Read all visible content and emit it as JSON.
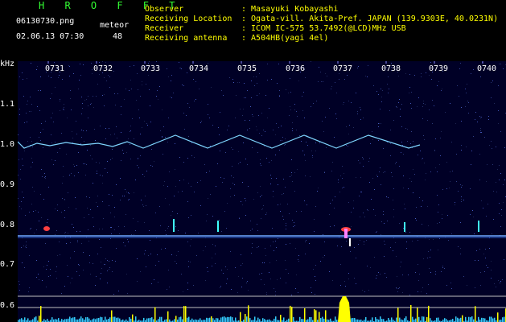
{
  "header": {
    "title": "H R O F F T",
    "filename": "06130730.png",
    "datetime": "02.06.13 07:30",
    "counter_label": "meteor",
    "counter_value": "48",
    "fields": [
      {
        "label": "Observer",
        "value": ": Masayuki Kobayashi"
      },
      {
        "label": "Receiving Location",
        "value": ": Ogata-vill. Akita-Pref. JAPAN (139.9303E, 40.0231N)"
      },
      {
        "label": "Receiver",
        "value": ": ICOM IC-575 53.7492(@LCD)MHz USB"
      },
      {
        "label": "Receiving antenna",
        "value": ": A504HB(yagi 4el)"
      }
    ]
  },
  "plot": {
    "y_unit": "kHz",
    "y_ticks": [
      "1.1",
      "1.0",
      "0.9",
      "0.8",
      "0.7",
      "0.6"
    ],
    "time_ticks": [
      "0731",
      "0732",
      "0733",
      "0734",
      "0735",
      "0736",
      "0737",
      "0738",
      "0739",
      "0740"
    ]
  }
}
